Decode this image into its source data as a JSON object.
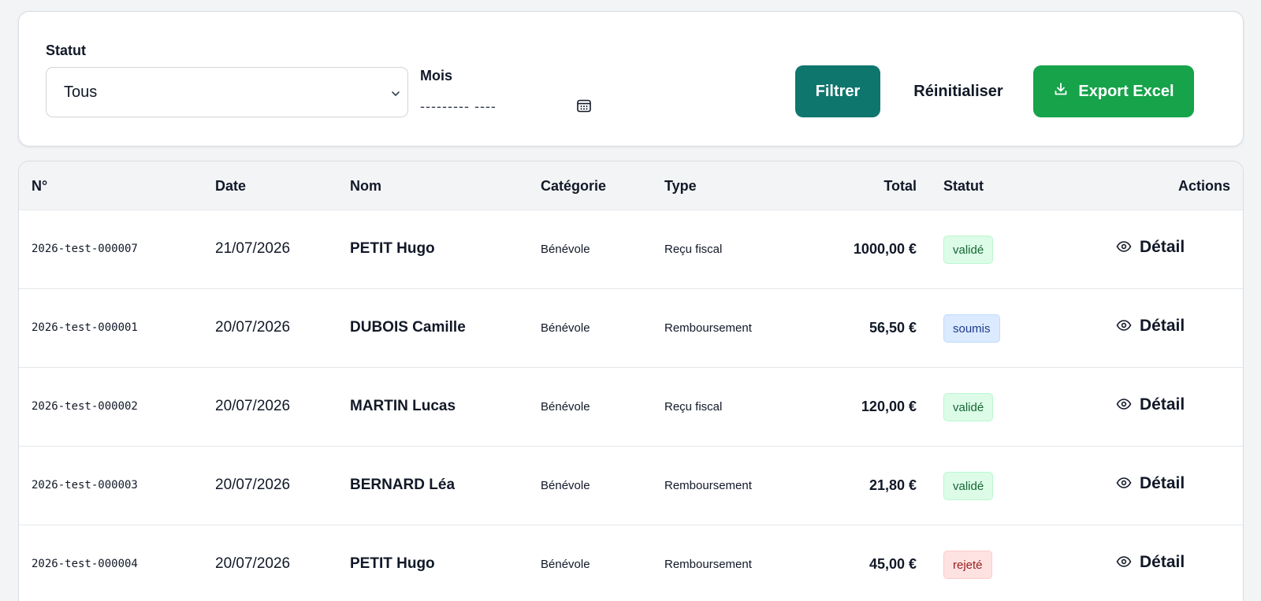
{
  "filters": {
    "statut_label": "Statut",
    "statut_value": "Tous",
    "mois_label": "Mois",
    "mois_placeholder": "--------- ----",
    "filtrer_label": "Filtrer",
    "reset_label": "Réinitialiser",
    "export_label": "Export Excel"
  },
  "table": {
    "headers": {
      "num": "N°",
      "date": "Date",
      "nom": "Nom",
      "categorie": "Catégorie",
      "type": "Type",
      "total": "Total",
      "statut": "Statut",
      "actions": "Actions"
    },
    "detail_label": "Détail",
    "rows": [
      {
        "num": "2026-test-000007",
        "date": "21/07/2026",
        "nom": "PETIT Hugo",
        "categorie": "Bénévole",
        "type": "Reçu fiscal",
        "total": "1000,00 €",
        "statut": "validé",
        "statut_kind": "valide"
      },
      {
        "num": "2026-test-000001",
        "date": "20/07/2026",
        "nom": "DUBOIS Camille",
        "categorie": "Bénévole",
        "type": "Remboursement",
        "total": "56,50 €",
        "statut": "soumis",
        "statut_kind": "soumis"
      },
      {
        "num": "2026-test-000002",
        "date": "20/07/2026",
        "nom": "MARTIN Lucas",
        "categorie": "Bénévole",
        "type": "Reçu fiscal",
        "total": "120,00 €",
        "statut": "validé",
        "statut_kind": "valide"
      },
      {
        "num": "2026-test-000003",
        "date": "20/07/2026",
        "nom": "BERNARD Léa",
        "categorie": "Bénévole",
        "type": "Remboursement",
        "total": "21,80 €",
        "statut": "validé",
        "statut_kind": "valide"
      },
      {
        "num": "2026-test-000004",
        "date": "20/07/2026",
        "nom": "PETIT Hugo",
        "categorie": "Bénévole",
        "type": "Remboursement",
        "total": "45,00 €",
        "statut": "rejeté",
        "statut_kind": "rejete"
      }
    ]
  },
  "colors": {
    "filtrer_bg": "#0f766e",
    "export_bg": "#16a34a"
  },
  "icons": {
    "select": "chevron-down-icon",
    "mois": "calendar-icon",
    "export": "download-icon",
    "detail": "eye-icon"
  }
}
